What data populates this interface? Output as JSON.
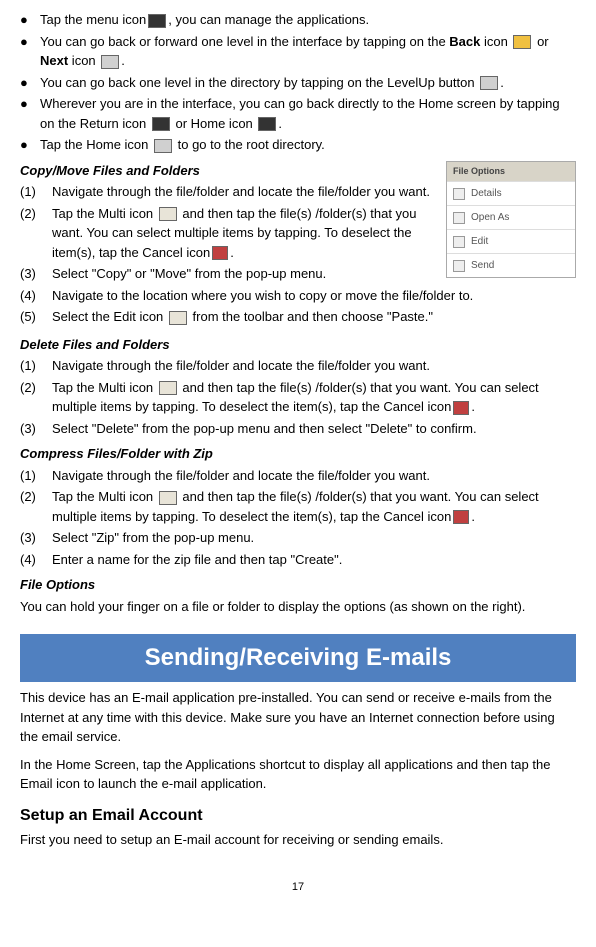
{
  "bullets": [
    {
      "pre": "Tap the menu icon",
      "iconClass": "dark",
      "iconName": "menu-icon",
      "post": ", you can manage the applications."
    }
  ],
  "bullet2": {
    "pre": "You can go back or forward one level in the interface by tapping on the ",
    "bold1": "Back",
    "mid1": " icon ",
    "or": " or ",
    "bold2": "Next",
    "mid2": " icon ",
    "end": "."
  },
  "bullet3": {
    "pre": "You can go back one level in the directory by tapping on the LevelUp button ",
    "end": "."
  },
  "bullet4": {
    "pre": "Wherever you are in the interface, you can go back directly to the Home screen by tapping on the Return icon ",
    "mid": " or Home icon ",
    "end": "."
  },
  "bullet5": {
    "pre": "Tap the Home icon ",
    "post": " to go to the root directory."
  },
  "popup": {
    "header": "File Options",
    "items": [
      "Details",
      "Open As",
      "Edit",
      "Send"
    ]
  },
  "copyMove": {
    "title": "Copy/Move Files and Folders",
    "items": [
      {
        "num": "(1)",
        "text": "Navigate through the file/folder and locate the file/folder you want."
      },
      {
        "num": "(2)",
        "pre": "Tap the Multi icon ",
        "mid": " and then tap the file(s) /folder(s) that you want. You can select multiple items by tapping. To deselect the item(s), tap the Cancel icon",
        "end": "."
      },
      {
        "num": "(3)",
        "text": "Select \"Copy\" or \"Move\" from the pop-up menu."
      },
      {
        "num": "(4)",
        "text": "Navigate to the location where you wish to copy or move the file/folder to."
      },
      {
        "num": "(5)",
        "pre": "Select the Edit icon ",
        "post": " from the toolbar and then choose \"Paste.\""
      }
    ]
  },
  "deleteSection": {
    "title": "Delete Files and Folders",
    "items": [
      {
        "num": "(1)",
        "text": "Navigate through the file/folder and locate the file/folder you want."
      },
      {
        "num": "(2)",
        "pre": "Tap the Multi icon ",
        "mid": " and then tap the file(s) /folder(s) that you want. You can select multiple items by tapping. To deselect the item(s), tap the Cancel icon",
        "end": "."
      },
      {
        "num": "(3)",
        "text": "Select \"Delete\" from the pop-up menu and then select \"Delete\" to confirm."
      }
    ]
  },
  "compressSection": {
    "title": "Compress Files/Folder with Zip",
    "items": [
      {
        "num": "(1)",
        "text": "Navigate through the file/folder and locate the file/folder you want."
      },
      {
        "num": "(2)",
        "pre": "Tap the Multi icon ",
        "mid": " and then tap the file(s) /folder(s) that you want. You can select multiple items by tapping. To deselect the item(s), tap the Cancel icon",
        "end": "."
      },
      {
        "num": "(3)",
        "text": "Select \"Zip\" from the pop-up menu."
      },
      {
        "num": "(4)",
        "text": "Enter a name for the zip file and then tap \"Create\"."
      }
    ]
  },
  "fileOptions": {
    "title": "File Options",
    "text": "You can hold your finger on a file or folder to display the options (as shown on the right)."
  },
  "emailBanner": "Sending/Receiving E-mails",
  "emailPara1": "This device has an E-mail application pre-installed. You can send or receive e-mails from the Internet at any time with this device. Make sure you have an Internet connection before using the email service.",
  "emailPara2": "In the Home Screen, tap the Applications shortcut to display all applications and then tap the Email icon to launch the e-mail application.",
  "setupHeading": "Setup an Email Account",
  "setupText": "First you need to setup an E-mail account for receiving or sending emails.",
  "pageNum": "17"
}
